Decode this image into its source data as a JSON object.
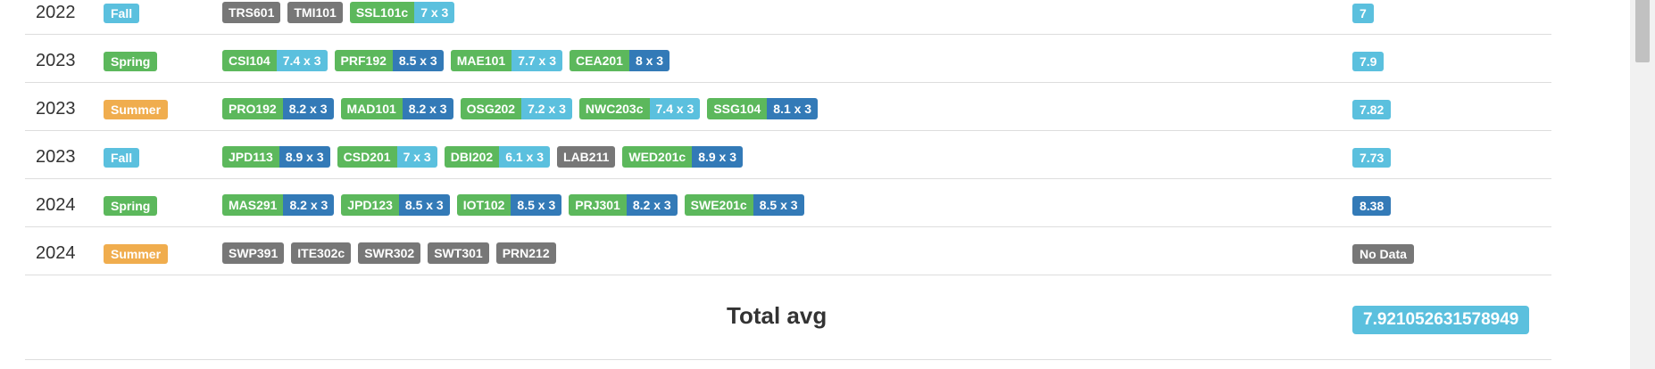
{
  "colors": {
    "green": "#5cb85c",
    "gray": "#777777",
    "lightblue": "#5bc0de",
    "blue": "#337ab7",
    "orange": "#f0ad4e"
  },
  "semesters": [
    {
      "year": "2022",
      "term": "Fall",
      "term_color": "lightblue",
      "courses": [
        {
          "code": "TRS601",
          "color": "gray",
          "score": null,
          "score_color": null
        },
        {
          "code": "TMI101",
          "color": "gray",
          "score": null,
          "score_color": null
        },
        {
          "code": "SSL101c",
          "color": "green",
          "score": "7 x 3",
          "score_color": "lightblue"
        }
      ],
      "avg": "7",
      "avg_color": "lightblue"
    },
    {
      "year": "2023",
      "term": "Spring",
      "term_color": "green",
      "courses": [
        {
          "code": "CSI104",
          "color": "green",
          "score": "7.4 x 3",
          "score_color": "lightblue"
        },
        {
          "code": "PRF192",
          "color": "green",
          "score": "8.5 x 3",
          "score_color": "blue"
        },
        {
          "code": "MAE101",
          "color": "green",
          "score": "7.7 x 3",
          "score_color": "lightblue"
        },
        {
          "code": "CEA201",
          "color": "green",
          "score": "8 x 3",
          "score_color": "blue"
        }
      ],
      "avg": "7.9",
      "avg_color": "lightblue"
    },
    {
      "year": "2023",
      "term": "Summer",
      "term_color": "orange",
      "courses": [
        {
          "code": "PRO192",
          "color": "green",
          "score": "8.2 x 3",
          "score_color": "blue"
        },
        {
          "code": "MAD101",
          "color": "green",
          "score": "8.2 x 3",
          "score_color": "blue"
        },
        {
          "code": "OSG202",
          "color": "green",
          "score": "7.2 x 3",
          "score_color": "lightblue"
        },
        {
          "code": "NWC203c",
          "color": "green",
          "score": "7.4 x 3",
          "score_color": "lightblue"
        },
        {
          "code": "SSG104",
          "color": "green",
          "score": "8.1 x 3",
          "score_color": "blue"
        }
      ],
      "avg": "7.82",
      "avg_color": "lightblue"
    },
    {
      "year": "2023",
      "term": "Fall",
      "term_color": "lightblue",
      "courses": [
        {
          "code": "JPD113",
          "color": "green",
          "score": "8.9 x 3",
          "score_color": "blue"
        },
        {
          "code": "CSD201",
          "color": "green",
          "score": "7 x 3",
          "score_color": "lightblue"
        },
        {
          "code": "DBI202",
          "color": "green",
          "score": "6.1 x 3",
          "score_color": "lightblue"
        },
        {
          "code": "LAB211",
          "color": "gray",
          "score": null,
          "score_color": null
        },
        {
          "code": "WED201c",
          "color": "green",
          "score": "8.9 x 3",
          "score_color": "blue"
        }
      ],
      "avg": "7.73",
      "avg_color": "lightblue"
    },
    {
      "year": "2024",
      "term": "Spring",
      "term_color": "green",
      "courses": [
        {
          "code": "MAS291",
          "color": "green",
          "score": "8.2 x 3",
          "score_color": "blue"
        },
        {
          "code": "JPD123",
          "color": "green",
          "score": "8.5 x 3",
          "score_color": "blue"
        },
        {
          "code": "IOT102",
          "color": "green",
          "score": "8.5 x 3",
          "score_color": "blue"
        },
        {
          "code": "PRJ301",
          "color": "green",
          "score": "8.2 x 3",
          "score_color": "blue"
        },
        {
          "code": "SWE201c",
          "color": "green",
          "score": "8.5 x 3",
          "score_color": "blue"
        }
      ],
      "avg": "8.38",
      "avg_color": "blue"
    },
    {
      "year": "2024",
      "term": "Summer",
      "term_color": "orange",
      "courses": [
        {
          "code": "SWP391",
          "color": "gray",
          "score": null,
          "score_color": null
        },
        {
          "code": "ITE302c",
          "color": "gray",
          "score": null,
          "score_color": null
        },
        {
          "code": "SWR302",
          "color": "gray",
          "score": null,
          "score_color": null
        },
        {
          "code": "SWT301",
          "color": "gray",
          "score": null,
          "score_color": null
        },
        {
          "code": "PRN212",
          "color": "gray",
          "score": null,
          "score_color": null
        }
      ],
      "avg": "No Data",
      "avg_color": "gray"
    }
  ],
  "total": {
    "label": "Total avg",
    "value": "7.921052631578949",
    "color": "lightblue"
  }
}
